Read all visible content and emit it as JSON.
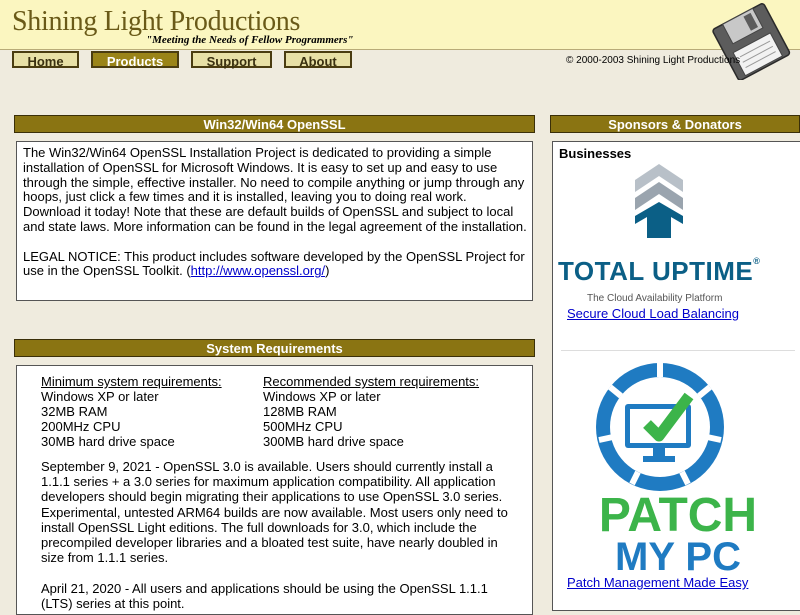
{
  "header": {
    "title": "Shining Light Productions",
    "tagline": "\"Meeting the Needs of Fellow Programmers\"",
    "copyright": "© 2000-2003 Shining Light Productions"
  },
  "nav": {
    "items": [
      {
        "label": "Home",
        "active": false
      },
      {
        "label": "Products",
        "active": true
      },
      {
        "label": "Support",
        "active": false
      },
      {
        "label": "About",
        "active": false
      }
    ]
  },
  "openssl_panel": {
    "title": "Win32/Win64 OpenSSL",
    "intro": "The Win32/Win64 OpenSSL Installation Project is dedicated to providing a simple installation of OpenSSL for Microsoft Windows. It is easy to set up and easy to use through the simple, effective installer. No need to compile anything or jump through any hoops, just click a few times and it is installed, leaving you to doing real work. Download it today! Note that these are default builds of OpenSSL and subject to local and state laws. More information can be found in the legal agreement of the installation.",
    "legal_prefix": "LEGAL NOTICE: This product includes software developed by the OpenSSL Project for use in the OpenSSL Toolkit. (",
    "legal_link": "http://www.openssl.org/",
    "legal_suffix": ")"
  },
  "requirements_panel": {
    "title": "System Requirements",
    "minimum": {
      "heading": "Minimum system requirements:",
      "items": [
        "Windows XP or later",
        "32MB RAM",
        "200MHz CPU",
        "30MB hard drive space"
      ]
    },
    "recommended": {
      "heading": "Recommended system requirements:",
      "items": [
        "Windows XP or later",
        "128MB RAM",
        "500MHz CPU",
        "300MB hard drive space"
      ]
    },
    "news": [
      "September 9, 2021 - OpenSSL 3.0 is available. Users should currently install a 1.1.1 series + a 3.0 series for maximum application compatibility. All application developers should begin migrating their applications to use OpenSSL 3.0 series. Experimental, untested ARM64 builds are now available. Most users only need to install OpenSSL Light editions. The full downloads for 3.0, which include the precompiled developer libraries and a bloated test suite, have nearly doubled in size from 1.1.1 series.",
      "April 21, 2020 - All users and applications should be using the OpenSSL 1.1.1 (LTS) series at this point."
    ]
  },
  "sponsors_panel": {
    "title": "Sponsors & Donators",
    "businesses_label": "Businesses",
    "sponsor1": {
      "logo_text": "TOTAL UPTIME",
      "logo_mark": "®",
      "logo_subtitle": "The Cloud Availability Platform",
      "link": "Secure Cloud Load Balancing"
    },
    "sponsor2": {
      "logo_line1": "PATCH",
      "logo_line2": "MY PC",
      "link": "Patch Management Made Easy"
    }
  },
  "colors": {
    "header_bg": "#fbf6c0",
    "page_bg": "#efebde",
    "panel_header_bg": "#8a7412",
    "title_color": "#6a5a18",
    "link_color": "#0000cc",
    "uptime_blue": "#0b5f86",
    "patch_green": "#3cb44a",
    "patch_blue": "#1f7bc2"
  }
}
